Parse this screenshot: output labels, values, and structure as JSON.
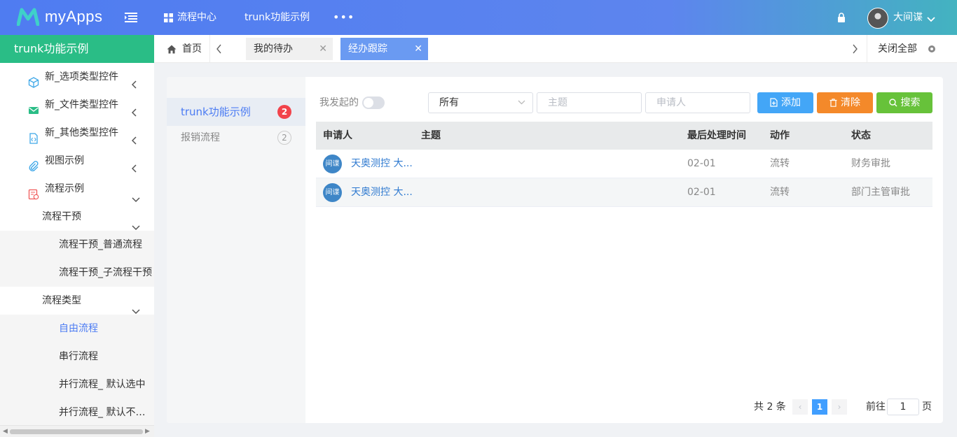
{
  "header": {
    "app_name": "myApps",
    "nav": [
      "流程中心",
      "trunk功能示例",
      "•••"
    ],
    "user_name": "大间谍"
  },
  "sidebar": {
    "title": "trunk功能示例",
    "items": [
      {
        "label": "新_选项类型控件",
        "icon": "cube-icon"
      },
      {
        "label": "新_文件类型控件",
        "icon": "mail-icon"
      },
      {
        "label": "新_其他类型控件",
        "icon": "code-file-icon"
      },
      {
        "label": "视图示例",
        "icon": "paperclip-icon"
      },
      {
        "label": "流程示例",
        "icon": "flow-doc-icon"
      },
      {
        "label": "流程干预"
      },
      {
        "label": "流程干预_普通流程"
      },
      {
        "label": "流程干预_子流程干预"
      },
      {
        "label": "流程类型"
      },
      {
        "label": "自由流程"
      },
      {
        "label": "串行流程"
      },
      {
        "label": "并行流程_ 默认选中"
      },
      {
        "label": "并行流程_ 默认不选中"
      }
    ]
  },
  "tabs": {
    "home": "首页",
    "todo": "我的待办",
    "track": "经办跟踪",
    "close_all": "关闭全部"
  },
  "left_panel": {
    "items": [
      {
        "label": "trunk功能示例",
        "count": "2"
      },
      {
        "label": "报销流程",
        "count": "2"
      }
    ]
  },
  "toolbar": {
    "mine_label": "我发起的",
    "mine_on": false,
    "status_select": "所有",
    "subject_placeholder": "主题",
    "applicant_placeholder": "申请人",
    "add_label": "添加",
    "clear_label": "清除",
    "search_label": "搜索"
  },
  "table": {
    "headers": [
      "申请人",
      "主题",
      "最后处理时间",
      "动作",
      "状态"
    ],
    "rows": [
      {
        "avatar": "间谍",
        "applicant": "天奥测控 大...",
        "subject": "",
        "time": "02-01",
        "action": "流转",
        "status": "财务审批"
      },
      {
        "avatar": "间谍",
        "applicant": "天奥测控 大...",
        "subject": "",
        "time": "02-01",
        "action": "流转",
        "status": "部门主管审批"
      }
    ]
  },
  "pagination": {
    "total": "共 2 条",
    "current": "1",
    "goto_label": "前往",
    "goto_value": "1",
    "page_suffix": "页"
  },
  "colors": {
    "header_start": "#4f7cf1",
    "header_end": "#43b3c0",
    "sidebar_title": "#2abd86",
    "accent": "#4c7cf3",
    "add": "#43a6f7",
    "clear": "#f4892a",
    "search": "#67c23a"
  }
}
